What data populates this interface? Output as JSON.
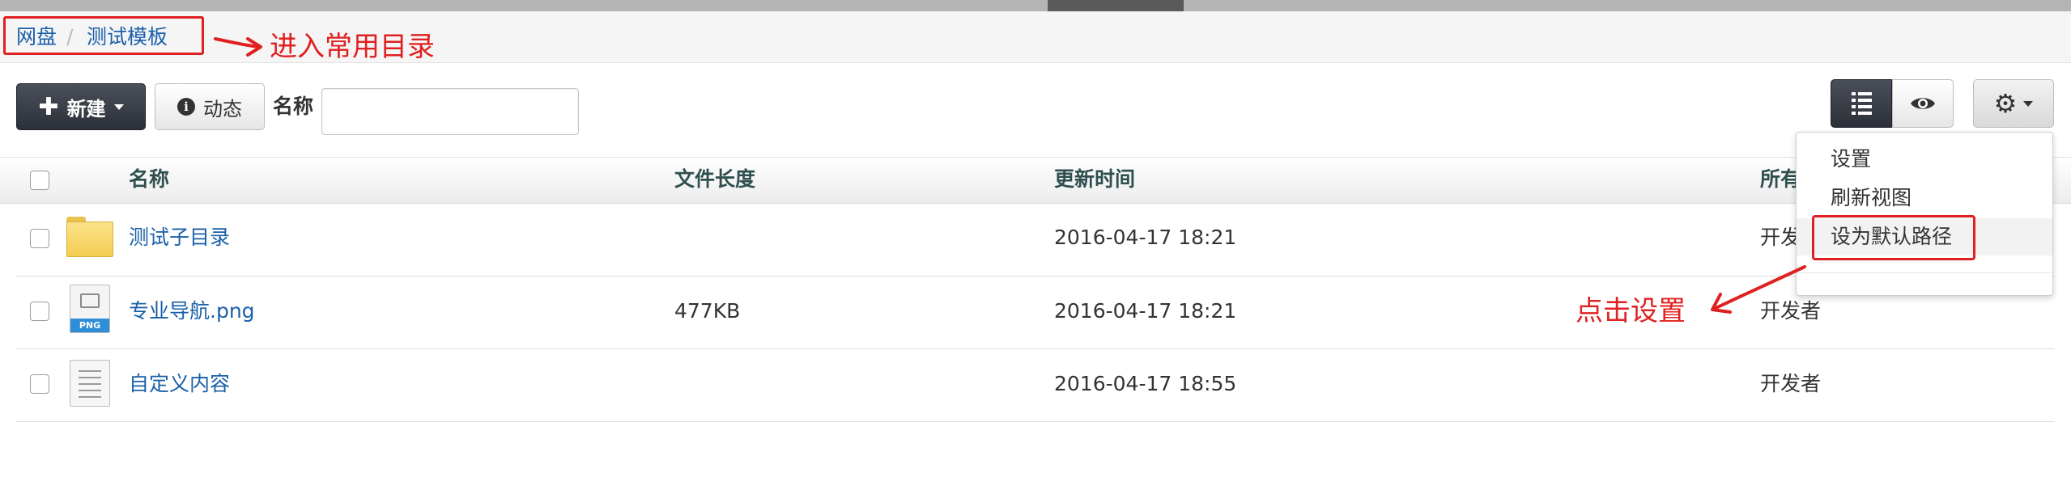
{
  "breadcrumb": {
    "root": "网盘",
    "separator": "/",
    "current": "测试模板"
  },
  "annotations": {
    "breadcrumb_note": "进入常用目录",
    "settings_note": "点击设置"
  },
  "toolbar": {
    "new_label": "新建",
    "activity_label": "动态",
    "name_label": "名称",
    "name_value": ""
  },
  "table": {
    "headers": {
      "name": "名称",
      "size": "文件长度",
      "updated": "更新时间",
      "owner": "所有者"
    },
    "rows": [
      {
        "type": "folder",
        "name": "测试子目录",
        "size": "",
        "updated": "2016-04-17 18:21",
        "owner": "开发者"
      },
      {
        "type": "png",
        "name": "专业导航.png",
        "size": "477KB",
        "updated": "2016-04-17 18:21",
        "owner": "开发者"
      },
      {
        "type": "document",
        "name": "自定义内容",
        "size": "",
        "updated": "2016-04-17 18:55",
        "owner": "开发者"
      }
    ]
  },
  "settings_menu": {
    "items": [
      "设置",
      "刷新视图",
      "设为默认路径"
    ],
    "highlighted_index": 2
  },
  "icons": {
    "png_tag": "PNG",
    "new": "plus-icon",
    "activity": "info-icon",
    "list_view": "list-icon",
    "preview": "eye-icon",
    "settings": "gear-icon"
  },
  "colors": {
    "link": "#1a5fa8",
    "annotation": "#e02020",
    "dark_button": "#2c3038"
  }
}
